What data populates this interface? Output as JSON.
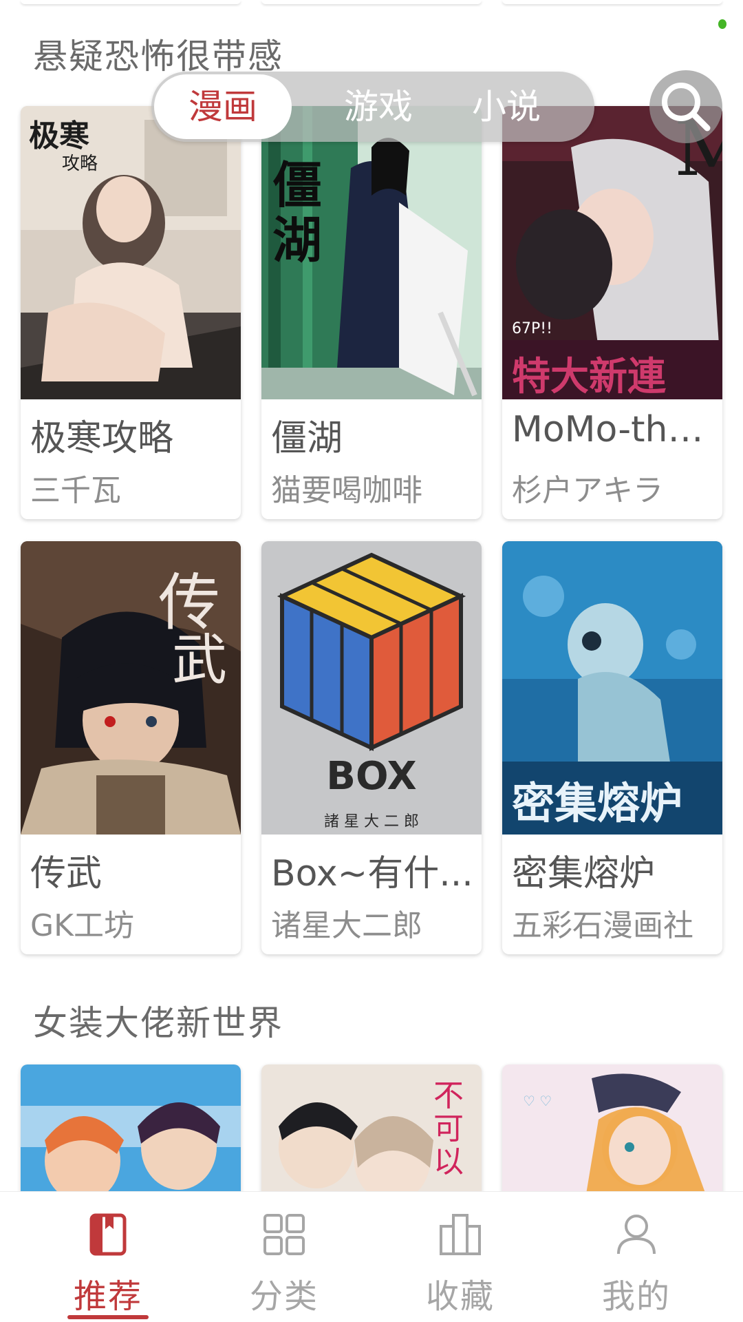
{
  "tabs": [
    {
      "label": "漫画",
      "active": true
    },
    {
      "label": "游戏",
      "active": false
    },
    {
      "label": "小说",
      "active": false
    }
  ],
  "sections": [
    {
      "title": "悬疑恐怖很带感",
      "items": [
        {
          "name": "极寒攻略",
          "author": "三千瓦"
        },
        {
          "name": "僵湖",
          "author": "猫要喝咖啡"
        },
        {
          "name": "MoMo-the...",
          "author": "杉户アキラ"
        },
        {
          "name": "传武",
          "author": "GK工坊"
        },
        {
          "name": "Box~有什...",
          "author": "诸星大二郎"
        },
        {
          "name": "密集熔炉",
          "author": "五彩石漫画社"
        }
      ]
    },
    {
      "title": "女装大佬新世界"
    }
  ],
  "bottom_nav": [
    {
      "label": "推荐",
      "icon": "book-icon",
      "active": true
    },
    {
      "label": "分类",
      "icon": "grid-icon",
      "active": false
    },
    {
      "label": "收藏",
      "icon": "bookshelf-icon",
      "active": false
    },
    {
      "label": "我的",
      "icon": "user-icon",
      "active": false
    }
  ],
  "colors": {
    "accent": "#c0393b",
    "inactive": "#a6a6a6",
    "online_dot": "#44b526"
  }
}
